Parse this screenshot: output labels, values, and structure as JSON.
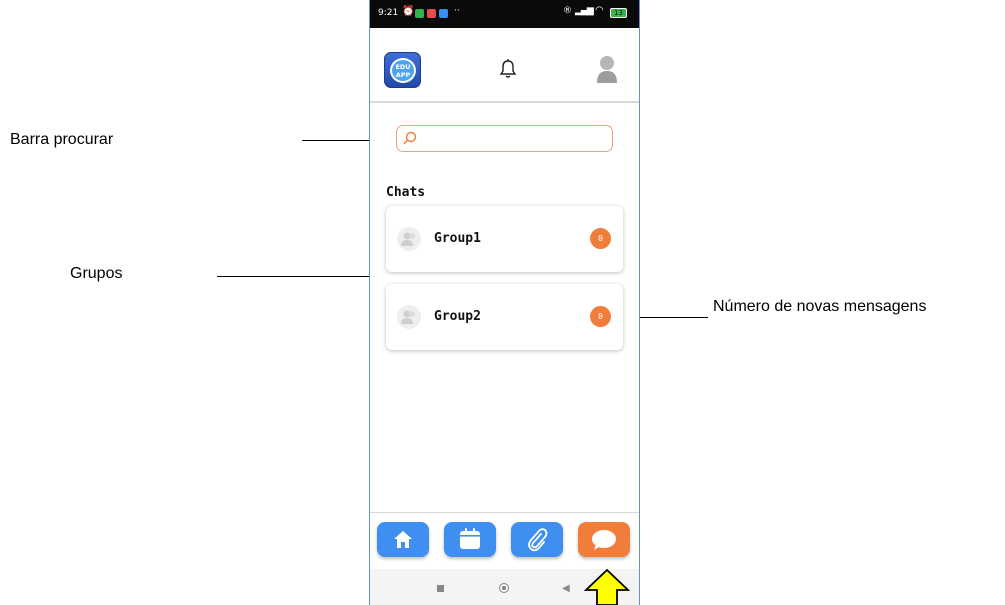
{
  "annotations": {
    "search": "Barra procurar",
    "groups": "Grupos",
    "new_messages": "Número de novas mensagens"
  },
  "status_bar": {
    "time": "9:21",
    "battery": "13"
  },
  "header": {
    "logo_text": "EDU APP",
    "icons": [
      "bell-icon",
      "user-avatar-icon"
    ]
  },
  "search": {
    "placeholder": "",
    "value": ""
  },
  "chats": {
    "title": "Chats",
    "groups": [
      {
        "name": "Group1",
        "unread": "0"
      },
      {
        "name": "Group2",
        "unread": "0"
      }
    ]
  },
  "bottom_nav": {
    "items": [
      "home-icon",
      "calendar-icon",
      "paperclip-icon",
      "chat-icon"
    ],
    "active": "chat-icon"
  },
  "colors": {
    "accent_orange": "#f07d3a",
    "nav_blue": "#3f8ff0",
    "arrow_yellow": "#ffff00"
  }
}
